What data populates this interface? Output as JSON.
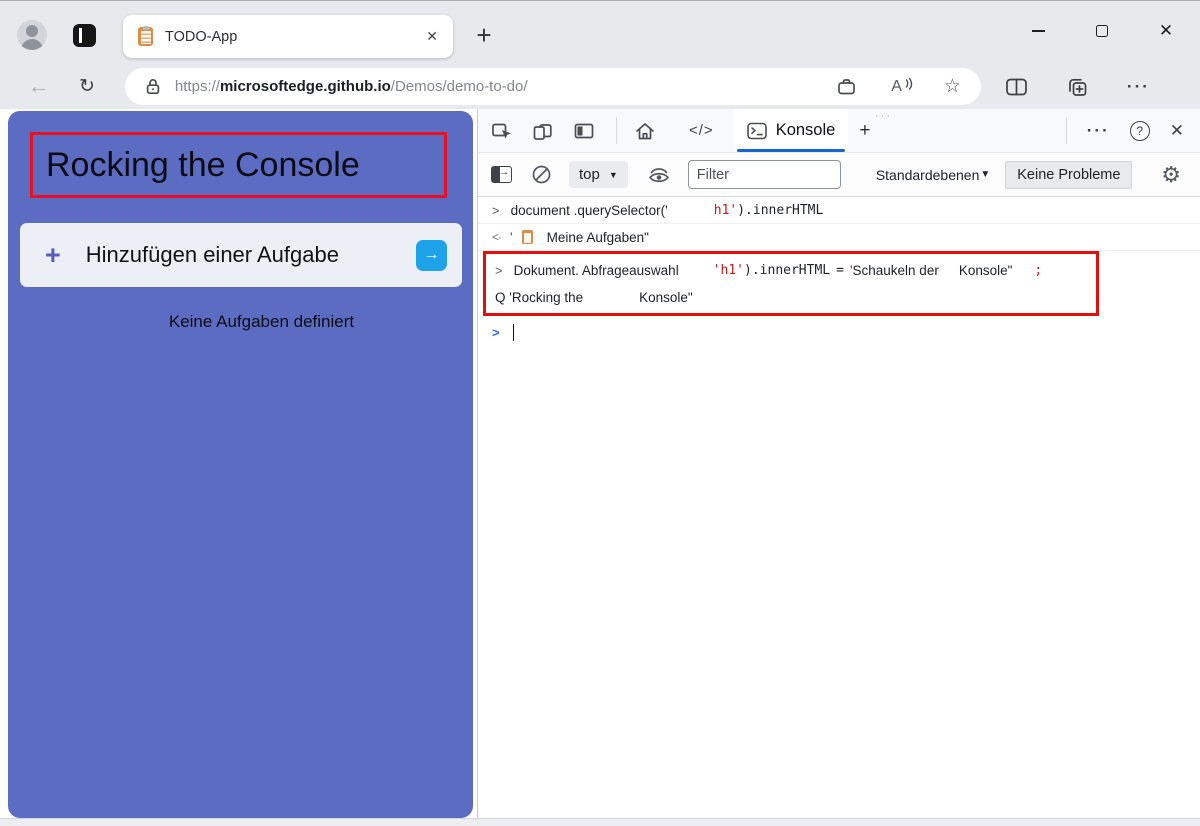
{
  "colors": {
    "app_purple": "#5c6cc2",
    "annotation_red": "#e81123",
    "devtools_accent_blue": "#1666d0",
    "console_token_red": "#c41a16",
    "prompt_blue": "#2c6ee2",
    "go_button_blue": "#1fa3e8"
  },
  "icons": {
    "back": "←",
    "reload": "↻",
    "star": "☆",
    "menu_dots": "···",
    "overflow_dots": "···",
    "code_tab": "</>",
    "help": "?",
    "close": "✕",
    "new_tab": "+",
    "caret_down": "▼",
    "gear": "⚙",
    "go_arrow": "→",
    "read_aloud": "A",
    "chevron": ">",
    "result_arrow": "<·",
    "prompt": ">"
  },
  "titlebar": {
    "tab_title": "TODO-App"
  },
  "addressbar": {
    "scheme": "https://",
    "host": "microsoftedge.github.io",
    "path": "/Demos/demo-to-do/"
  },
  "page": {
    "title": "Rocking the Console",
    "add_plus": "+",
    "add_label": "Hinzufügen einer Aufgabe",
    "empty_state": "Keine Aufgaben definiert"
  },
  "devtools": {
    "console_tab": "Konsole",
    "toolbar": {
      "context": "top",
      "filter_placeholder": "Filter",
      "levels": "Standardebenen",
      "issues": "Keine Probleme"
    },
    "console": {
      "l1_sans": "document .querySelector('",
      "l1_red": "h1'",
      "l1_mono": ").innerHTML",
      "l2_quote": "'",
      "l2_text": "Meine Aufgaben\"",
      "l3_sans": "Dokument. Abfrageauswahl",
      "l3_red1": "'h1'",
      "l3_mono1": ").innerHTML",
      "l3_eq": "=",
      "l3_quote": "'",
      "l3_sans2": "Schaukeln der",
      "l3_sans3": "Konsole\"",
      "l3_semi": ";",
      "l4_a": "Q 'Rocking the",
      "l4_b": "Konsole\""
    }
  }
}
